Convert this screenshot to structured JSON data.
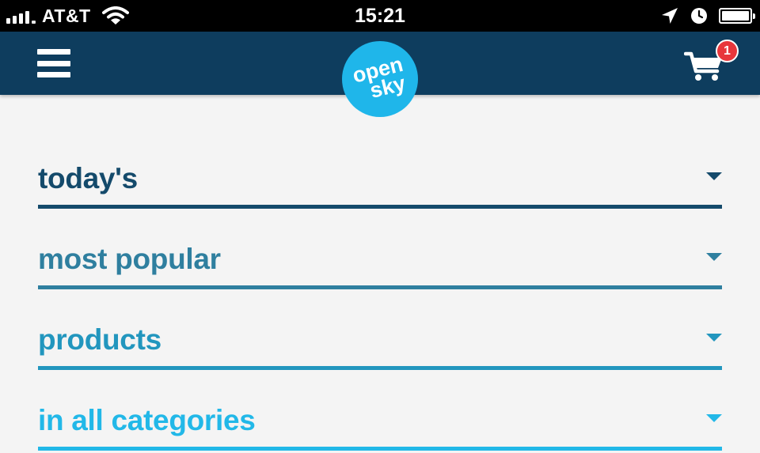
{
  "status_bar": {
    "carrier": "AT&T",
    "time": "15:21"
  },
  "header": {
    "logo_line1": "open",
    "logo_line2": "sky",
    "cart_count": "1"
  },
  "sections": [
    {
      "label": "today's",
      "color": "#144a6b"
    },
    {
      "label": "most popular",
      "color": "#2f7f9f"
    },
    {
      "label": "products",
      "color": "#2296be"
    },
    {
      "label": "in all categories",
      "color": "#22b8e8"
    }
  ],
  "icons": {
    "menu": "hamburger-menu-icon",
    "cart": "shopping-cart-icon",
    "location": "location-arrow-icon",
    "alarm": "clock-icon",
    "battery": "battery-icon",
    "wifi": "wifi-icon",
    "signal": "signal-bars-icon"
  },
  "colors": {
    "header_bg": "#0e3d5e",
    "logo_bg": "#1fb6ea",
    "badge_bg": "#e8363b"
  }
}
